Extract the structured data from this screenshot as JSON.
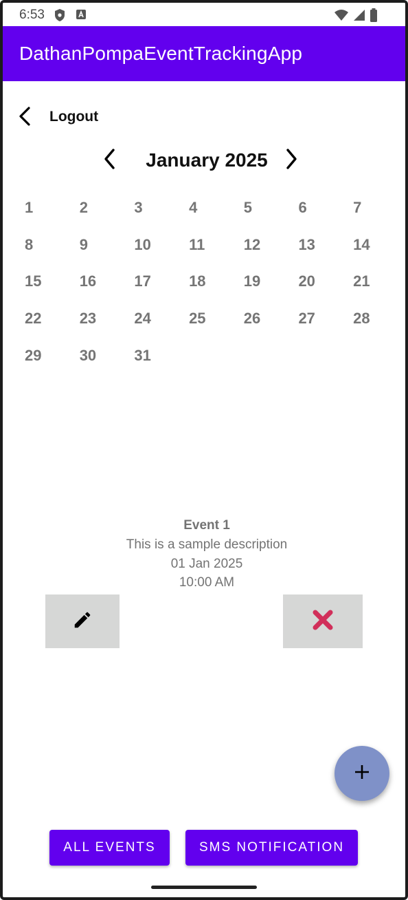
{
  "status_bar": {
    "time": "6:53",
    "icons": [
      "shield-icon",
      "a-notification-icon",
      "wifi-icon",
      "signal-icon",
      "battery-icon"
    ]
  },
  "app_bar": {
    "title": "DathanPompaEventTrackingApp",
    "color": "#6200ee"
  },
  "logout": {
    "label": "Logout",
    "icon": "back-arrow-icon"
  },
  "calendar": {
    "month_title": "January 2025",
    "prev_icon": "chevron-left-icon",
    "next_icon": "chevron-right-icon",
    "days": [
      "1",
      "2",
      "3",
      "4",
      "5",
      "6",
      "7",
      "8",
      "9",
      "10",
      "11",
      "12",
      "13",
      "14",
      "15",
      "16",
      "17",
      "18",
      "19",
      "20",
      "21",
      "22",
      "23",
      "24",
      "25",
      "26",
      "27",
      "28",
      "29",
      "30",
      "31"
    ]
  },
  "event": {
    "title": "Event 1",
    "description": "This is a sample description",
    "date": "01 Jan 2025",
    "time": "10:00 AM",
    "edit_icon": "pencil-icon",
    "delete_icon": "close-x-icon",
    "delete_color": "#d12f5a"
  },
  "fab": {
    "icon": "plus-icon",
    "color": "#7f91c8"
  },
  "buttons": {
    "all_events": "ALL EVENTS",
    "sms_notification": "SMS NOTIFICATION"
  }
}
